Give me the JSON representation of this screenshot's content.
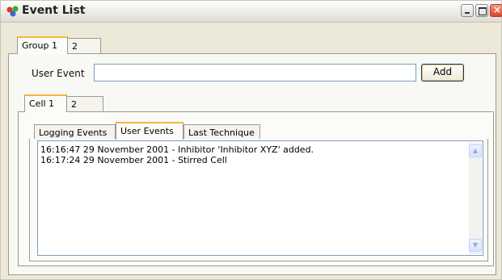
{
  "window": {
    "title": "Event List"
  },
  "group_tabs": [
    {
      "label": "Group 1"
    },
    {
      "label": "2"
    }
  ],
  "user_event": {
    "label": "User Event",
    "value": "",
    "add_label": "Add"
  },
  "cell_tabs": [
    {
      "label": "Cell 1"
    },
    {
      "label": "2"
    }
  ],
  "event_tabs": [
    {
      "label": "Logging Events"
    },
    {
      "label": "User Events"
    },
    {
      "label": "Last Technique"
    }
  ],
  "active_event_tab": "User Events",
  "events": [
    "16:16:47  29 November 2001  -  Inhibitor 'Inhibitor XYZ' added.",
    "16:17:24  29 November 2001  -  Stirred Cell"
  ],
  "colors": {
    "accent_tab": "#f7b53f",
    "close_button": "#d8452a"
  }
}
